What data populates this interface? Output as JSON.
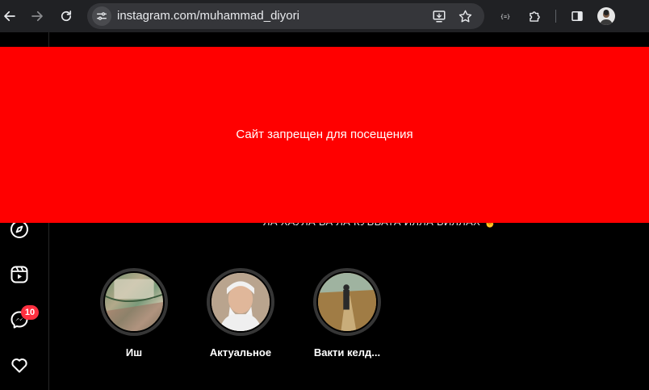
{
  "browser": {
    "url": "instagram.com/muhammad_diyori",
    "colors": {
      "chrome_bg": "#202124",
      "omnibox_bg": "#35363a",
      "url_text": "#e8eaed"
    },
    "icons": [
      "back-arrow-icon",
      "forward-arrow-icon",
      "reload-icon",
      "site-settings-icon",
      "install-app-icon",
      "bookmark-star-icon",
      "extension-json-icon",
      "extensions-puzzle-icon",
      "side-panel-icon",
      "profile-avatar"
    ]
  },
  "overlay": {
    "message": "Сайт запрещен для посещения",
    "color": "#ff0000"
  },
  "profile": {
    "bio_partial": "ЛА ХАУЛА ВА ЛА КУВВАТА ИЛЛА БИЛЛАХ ☝️",
    "highlights": [
      {
        "label": "Иш"
      },
      {
        "label": "Актуальное"
      },
      {
        "label": "Вакти келд..."
      }
    ]
  },
  "sidebar": {
    "items": [
      {
        "name": "explore",
        "icon": "compass-icon"
      },
      {
        "name": "reels",
        "icon": "reels-icon"
      },
      {
        "name": "messages",
        "icon": "messenger-icon",
        "badge": "10"
      },
      {
        "name": "notifications",
        "icon": "heart-icon"
      }
    ],
    "badge_color": "#ff3040"
  }
}
